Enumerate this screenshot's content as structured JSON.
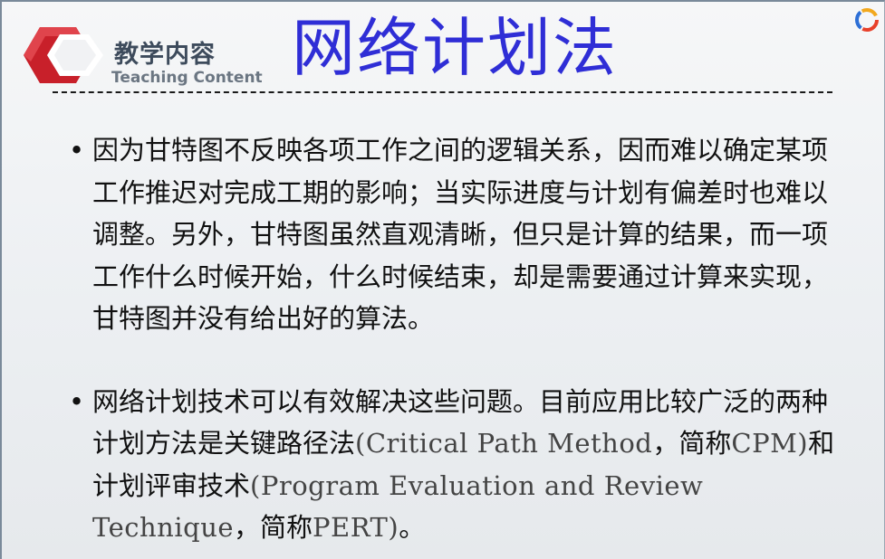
{
  "header": {
    "section_zh": "教学内容",
    "section_en": "Teaching Content",
    "title": "网络计划法",
    "brand_colors": {
      "red": "#c8202a",
      "title_blue": "#2f2ed6"
    }
  },
  "bullets": [
    {
      "text": "因为甘特图不反映各项工作之间的逻辑关系，因而难以确定某项工作推迟对完成工期的影响；当实际进度与计划有偏差时也难以调整。另外，甘特图虽然直观清晰，但只是计算的结果，而一项工作什么时候开始，什么时候结束，却是需要通过计算来实现，甘特图并没有给出好的算法。"
    },
    {
      "part1": "网络计划技术可以有效解决这些问题。目前应用比较广泛的两种计划方法是关键路径法",
      "part2": "(Critical Path Method",
      "part3": "，简称",
      "part4": "CPM)",
      "part5": "和计划评审技术",
      "part6": "(Program Evaluation and Review Technique",
      "part7": "，简称",
      "part8": "PERT)",
      "part9": "。"
    }
  ],
  "icons": {
    "logo": "red-hexagon-logo-icon",
    "corner": "circular-brand-icon"
  }
}
